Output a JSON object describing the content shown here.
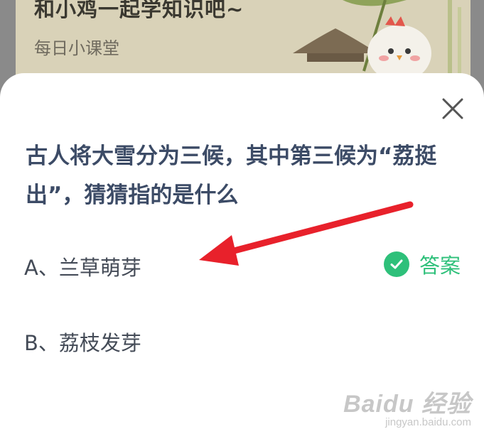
{
  "header": {
    "title": "和小鸡一起学知识吧~",
    "subtitle": "每日小课堂"
  },
  "quiz": {
    "question": "古人将大雪分为三候，其中第三候为“荔挺出”，猜猜指的是什么",
    "options": [
      {
        "label": "A、兰草萌芽",
        "is_answer": true
      },
      {
        "label": "B、荔枝发芽",
        "is_answer": false
      }
    ],
    "answer_label": "答案"
  },
  "icons": {
    "close": "close-icon",
    "answer": "check-circle-icon"
  },
  "colors": {
    "question_text": "#3c4b66",
    "answer_green": "#2ec07a",
    "annotation_arrow": "#e8212b"
  },
  "watermark": {
    "logo": "Baidu 经验",
    "url": "jingyan.baidu.com"
  }
}
